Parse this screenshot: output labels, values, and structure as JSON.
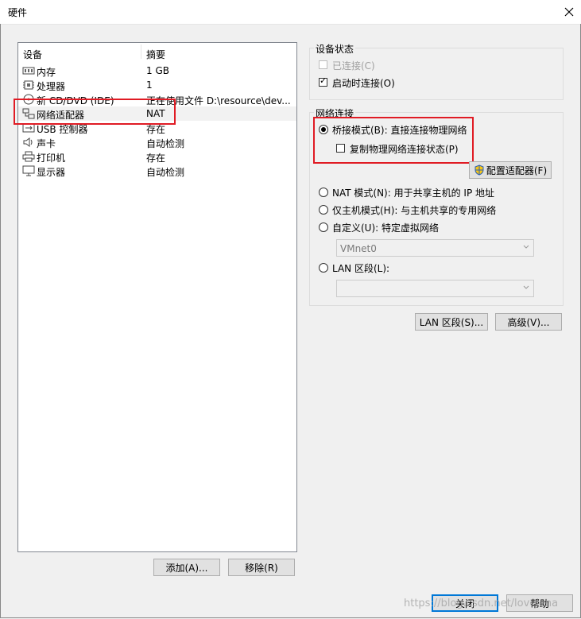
{
  "window": {
    "title": "硬件"
  },
  "device_list": {
    "header_device": "设备",
    "header_summary": "摘要",
    "rows": [
      {
        "name": "内存",
        "summary": "1 GB",
        "icon": "memory-icon"
      },
      {
        "name": "处理器",
        "summary": "1",
        "icon": "cpu-icon"
      },
      {
        "name": "新 CD/DVD (IDE)",
        "summary": "正在使用文件 D:\\resource\\dev...",
        "icon": "cd-icon"
      },
      {
        "name": "网络适配器",
        "summary": "NAT",
        "icon": "network-adapter-icon"
      },
      {
        "name": "USB 控制器",
        "summary": "存在",
        "icon": "usb-icon"
      },
      {
        "name": "声卡",
        "summary": "自动检测",
        "icon": "speaker-icon"
      },
      {
        "name": "打印机",
        "summary": "存在",
        "icon": "printer-icon"
      },
      {
        "name": "显示器",
        "summary": "自动检测",
        "icon": "monitor-icon"
      }
    ],
    "add_button": "添加(A)...",
    "remove_button": "移除(R)"
  },
  "device_status": {
    "title": "设备状态",
    "connected_label": "已连接(C)",
    "connected_checked": false,
    "connect_on_power_label": "启动时连接(O)",
    "connect_on_power_checked": true
  },
  "network_connection": {
    "title": "网络连接",
    "bridged_label": "桥接模式(B): 直接连接物理网络",
    "replicate_label": "复制物理网络连接状态(P)",
    "configure_adapters_button": "配置适配器(F)",
    "nat_label": "NAT 模式(N): 用于共享主机的 IP 地址",
    "host_only_label": "仅主机模式(H): 与主机共享的专用网络",
    "custom_label": "自定义(U): 特定虚拟网络",
    "custom_value": "VMnet0",
    "lan_segment_label": "LAN 区段(L):",
    "lan_segment_value": "",
    "selected": "bridged"
  },
  "actions": {
    "lan_segments_button": "LAN 区段(S)...",
    "advanced_button": "高级(V)..."
  },
  "footer": {
    "close_button": "关闭",
    "help_button": "帮助",
    "watermark": "https://blog.csdn.net/lovelena"
  },
  "colors": {
    "highlight_red": "#e01b24",
    "button_focus": "#0078d7"
  }
}
